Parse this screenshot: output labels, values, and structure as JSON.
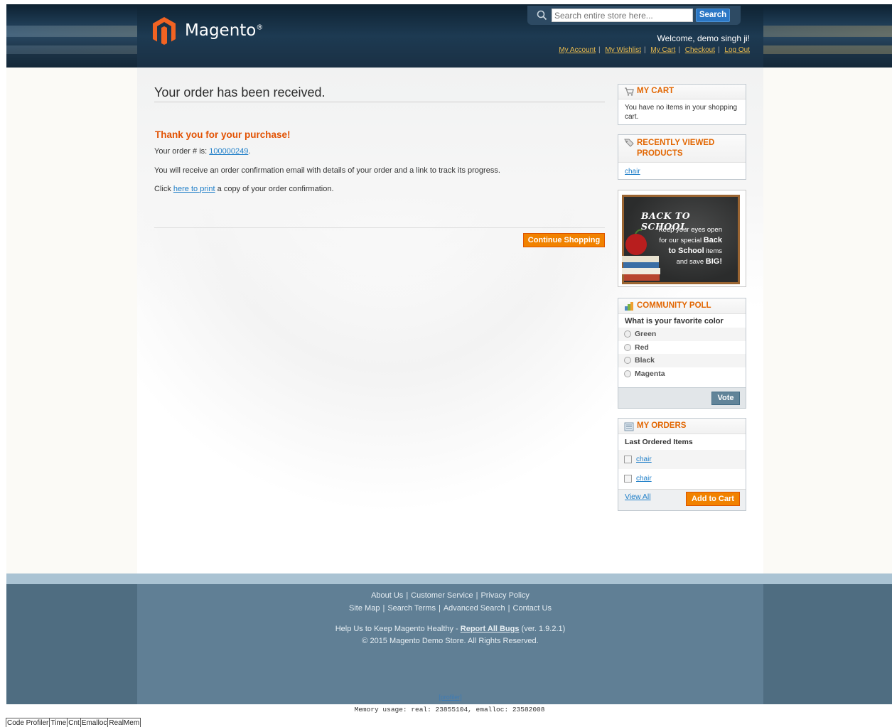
{
  "header": {
    "logo_text": "Magento",
    "logo_mark": "®",
    "search": {
      "placeholder": "Search entire store here...",
      "button_label": "Search"
    },
    "welcome": "Welcome, demo singh ji!",
    "links": [
      "My Account",
      "My Wishlist",
      "My Cart",
      "Checkout",
      "Log Out"
    ],
    "colors": {
      "links": "#ebbc4e",
      "search_button": "#2b77c5"
    }
  },
  "main": {
    "title": "Your order has been received.",
    "thanks": "Thank you for your purchase!",
    "order_prefix": "Your order # is: ",
    "order_number": "100000249",
    "order_suffix": ".",
    "email_text": "You will receive an order confirmation email with details of your order and a link to track its progress.",
    "print_prefix": "Click ",
    "print_link": "here to print",
    "print_suffix": " a copy of your order confirmation.",
    "continue_button": "Continue Shopping"
  },
  "sidebar": {
    "cart": {
      "title": "MY CART",
      "icon": "cart-icon",
      "text": "You have no items in your shopping cart."
    },
    "recent": {
      "title": "RECENTLY VIEWED PRODUCTS",
      "icon": "tag-icon",
      "items": [
        "chair"
      ]
    },
    "banner": {
      "heading": "BACK TO SCHOOL",
      "line1": "Keep your eyes open",
      "line2_a": "for our special ",
      "line2_b": "Back",
      "line3_a": "to School",
      "line3_b": " items",
      "line4_a": "and save ",
      "line4_b": "BIG!"
    },
    "poll": {
      "title": "COMMUNITY POLL",
      "icon": "poll-icon",
      "question": "What is your favorite color",
      "options": [
        "Green",
        "Red",
        "Black",
        "Magenta"
      ],
      "vote_button": "Vote"
    },
    "orders": {
      "title": "MY ORDERS",
      "icon": "orders-icon",
      "subtitle": "Last Ordered Items",
      "items": [
        "chair",
        "chair"
      ],
      "view_all": "View All",
      "add_button": "Add to Cart"
    }
  },
  "footer": {
    "row1": [
      "About Us",
      "Customer Service",
      "Privacy Policy"
    ],
    "row2": [
      "Site Map",
      "Search Terms",
      "Advanced Search",
      "Contact Us"
    ],
    "help_prefix": "Help Us to Keep Magento Healthy - ",
    "help_link": "Report All Bugs",
    "help_suffix": " (ver. 1.9.2.1)",
    "copyright": "© 2015 Magento Demo Store. All Rights Reserved.",
    "profiler_link": "[profiler]"
  },
  "debug": {
    "memory": "Memory usage: real: 23855104, emalloc: 23582008",
    "profiler_columns": [
      "Code Profiler",
      "Time",
      "Cnt",
      "Emalloc",
      "RealMem"
    ]
  }
}
